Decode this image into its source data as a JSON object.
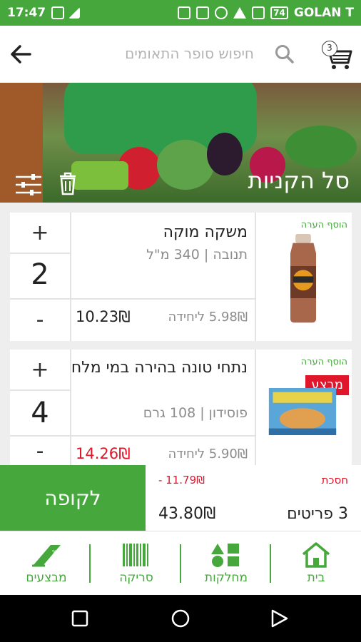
{
  "status_bar": {
    "time": "17:47",
    "carrier": "GOLAN T",
    "battery": "74"
  },
  "search": {
    "placeholder": "חיפוש סופר התאומים",
    "cart_count": "3"
  },
  "banner": {
    "title": "סל הקניות"
  },
  "products": [
    {
      "name": "משקה מוקה",
      "description": "תנובה | 340 מ\"ל",
      "unit_price": "5.98₪ ליחידה",
      "total": "10.23₪",
      "quantity": "2",
      "add_note": "הוסף הערה",
      "plus": "+",
      "minus": "-"
    },
    {
      "name": "נתחי טונה בהירה במי מלח",
      "description": "פוסידון | 108 גרם",
      "unit_price": "5.90₪ ליחידה",
      "total": "14.26₪",
      "quantity": "4",
      "add_note": "הוסף הערה",
      "deal_badge": "מבצע",
      "plus": "+",
      "minus": "-"
    }
  ],
  "summary": {
    "savings_label": "חסכת",
    "savings_value": "- 11.79₪",
    "items_label": "3 פריטים",
    "total": "43.80₪",
    "checkout_label": "לקופה"
  },
  "bottom_nav": [
    {
      "label": "מבצעים",
      "icon": "sale-tag-icon"
    },
    {
      "label": "סריקה",
      "icon": "barcode-icon"
    },
    {
      "label": "מחלקות",
      "icon": "categories-icon"
    },
    {
      "label": "בית",
      "icon": "home-icon"
    }
  ],
  "colors": {
    "brand_green": "#45a73c",
    "price_red": "#e0162b"
  }
}
